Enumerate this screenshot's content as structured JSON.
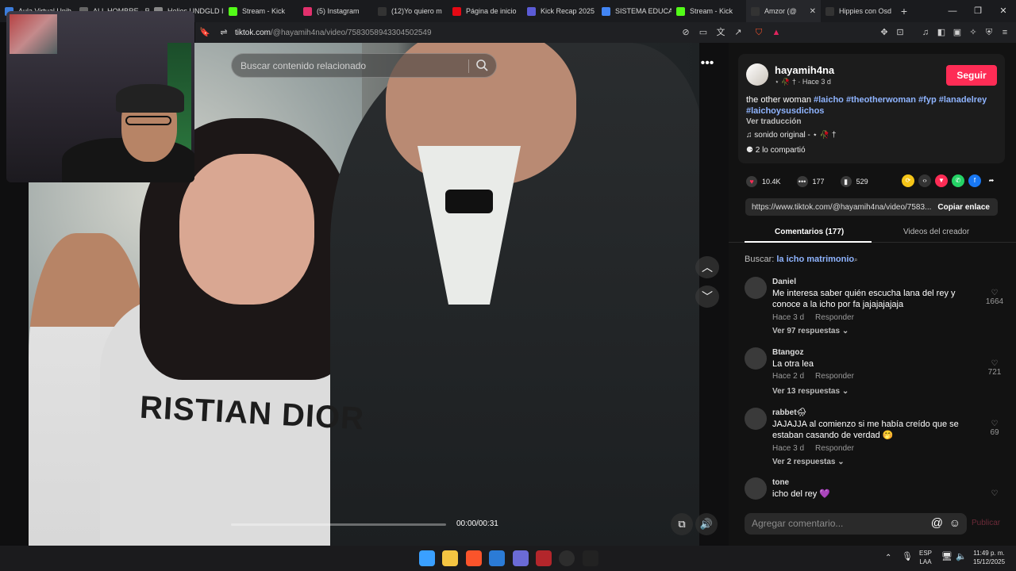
{
  "browser": {
    "tabs": [
      {
        "label": "Aula Virtual Unib",
        "color": "#3c7ddc"
      },
      {
        "label": "ALL HOMBRE - R",
        "color": "#666"
      },
      {
        "label": "Helios UNDGLD I",
        "color": "#888"
      },
      {
        "label": "Stream - Kick",
        "color": "#53fc18"
      },
      {
        "label": "(5) Instagram",
        "color": "#e1306c"
      },
      {
        "label": "(12)Yo quiero m",
        "color": "#222"
      },
      {
        "label": "Página de inicio",
        "color": "#e50914"
      },
      {
        "label": "Kick Recap 2025",
        "color": "#5b5bd6"
      },
      {
        "label": "SISTEMA EDUCAT",
        "color": "#4285f4"
      },
      {
        "label": "Stream - Kick",
        "color": "#53fc18"
      },
      {
        "label": "Amzor (@",
        "color": "#222"
      },
      {
        "label": "Hippies con Osd",
        "color": "#222"
      }
    ],
    "new_tab": "+",
    "url_host": "tiktok.com",
    "url_path": "/@hayamih4na/video/7583058943304502549"
  },
  "video": {
    "search_placeholder": "Buscar contenido relacionado",
    "shirt_text": "RISTIAN DIOR",
    "time": "00:00/00:31",
    "progress": 0
  },
  "post": {
    "username": "hayamih4na",
    "subline": "⋆ 🥀 † · Hace 3 d",
    "follow_label": "Seguir",
    "desc_text": "the other woman",
    "hashtags": [
      "#laicho",
      "#theotherwoman",
      "#fyp",
      "#lanadelrey",
      "#laichoysusdichos"
    ],
    "translate": "Ver traducción",
    "sound": "sonido original - ⋆ 🥀 †",
    "shared": "2 lo compartió",
    "likes": "10.4K",
    "comments": "177",
    "saves": "529",
    "link": "https://www.tiktok.com/@hayamih4na/video/7583...",
    "copy_label": "Copiar enlace"
  },
  "tabs": {
    "comments": "Comentarios (177)",
    "creator": "Videos del creador"
  },
  "query": {
    "prefix": "Buscar:",
    "term": "la icho matrimonio"
  },
  "comments": [
    {
      "name": "Daniel",
      "text": "Me interesa saber quién escucha lana del rey y conoce a la icho por fa jajajajajaja",
      "time": "Hace 3 d",
      "reply": "Responder",
      "replies": "Ver 97 respuestas",
      "likes": "1664"
    },
    {
      "name": "Btangoz",
      "text": "La otra lea",
      "time": "Hace 2 d",
      "reply": "Responder",
      "replies": "Ver 13 respuestas",
      "likes": "721"
    },
    {
      "name": "rabbet🌧",
      "text": "JAJAJJA al comienzo si me había creído que se estaban casando de verdad 🤭",
      "time": "Hace 3 d",
      "reply": "Responder",
      "replies": "Ver 2 respuestas",
      "likes": "69"
    },
    {
      "name": "tone",
      "text": "icho del rey 💜",
      "time": "",
      "reply": "",
      "replies": "",
      "likes": ""
    }
  ],
  "compose": {
    "placeholder": "Agregar comentario...",
    "publish": "Publicar"
  },
  "taskbar": {
    "lang": "ESP",
    "lang2": "LAA",
    "time": "11:49 p. m.",
    "date": "15/12/2025"
  }
}
